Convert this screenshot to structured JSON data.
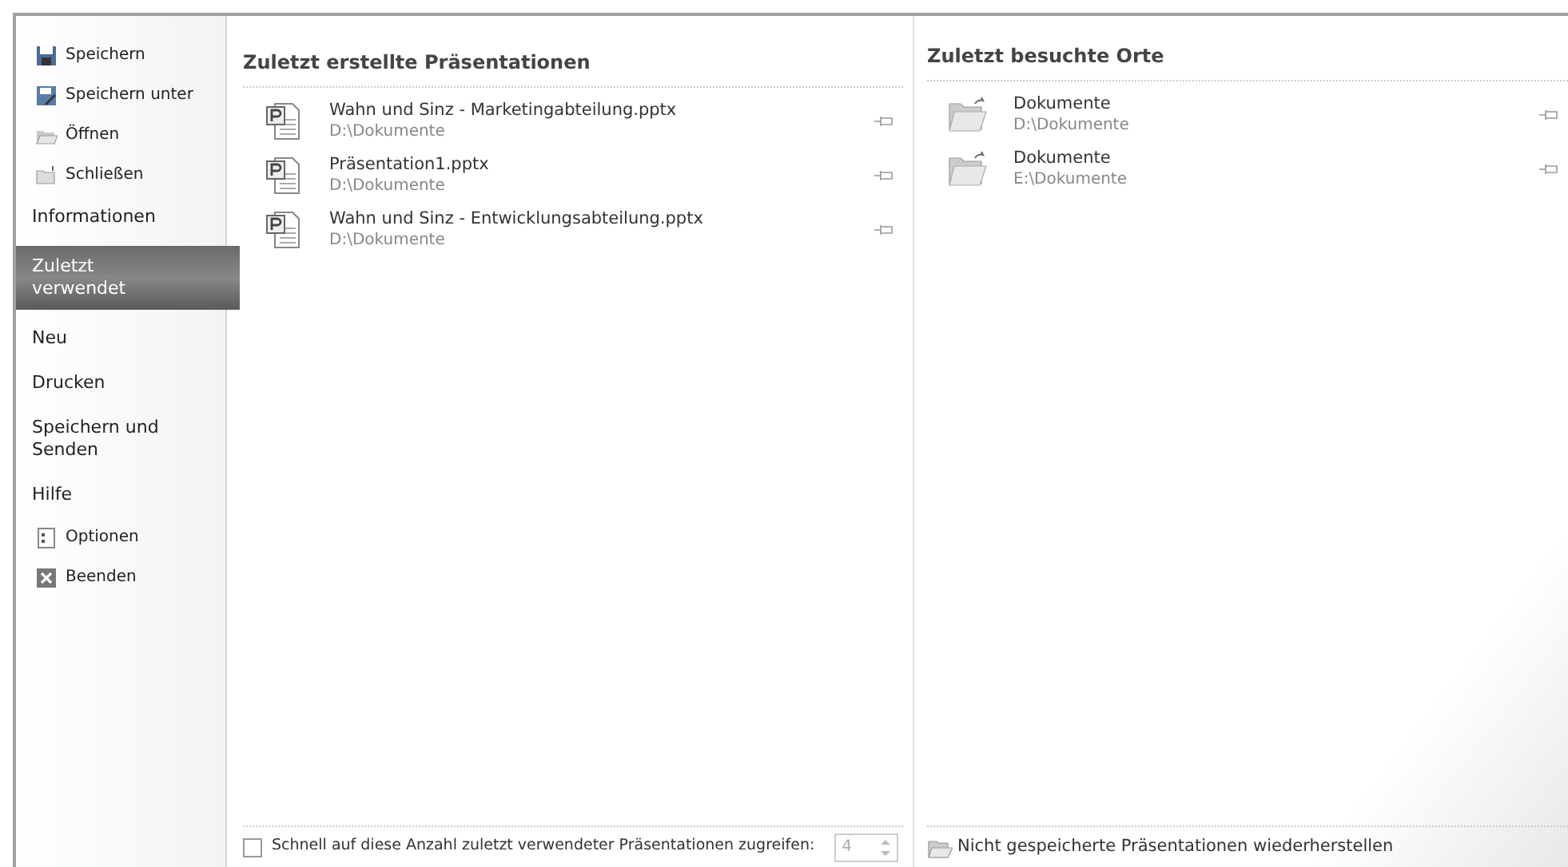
{
  "sidebar": {
    "items": [
      {
        "kind": "command",
        "label": "Speichern",
        "selected": false
      },
      {
        "kind": "command",
        "label": "Speichern unter",
        "selected": false
      },
      {
        "kind": "command",
        "label": "Öffnen",
        "selected": false
      },
      {
        "kind": "command",
        "label": "Schließen",
        "selected": false
      },
      {
        "kind": "tab",
        "label": "Informationen",
        "selected": false
      },
      {
        "kind": "tab",
        "label": "Zuletzt verwendet",
        "selected": true
      },
      {
        "kind": "tab",
        "label": "Neu",
        "selected": false
      },
      {
        "kind": "tab",
        "label": "Drucken",
        "selected": false
      },
      {
        "kind": "tab",
        "label": "Speichern und Senden",
        "selected": false
      },
      {
        "kind": "tab",
        "label": "Hilfe",
        "selected": false
      },
      {
        "kind": "command",
        "label": "Optionen",
        "selected": false
      },
      {
        "kind": "command",
        "label": "Beenden",
        "selected": false
      }
    ]
  },
  "recent_presentations": {
    "title": "Zuletzt erstellte Präsentationen",
    "items": [
      {
        "name": "Wahn und Sinz - Marketingabteilung.pptx",
        "path": "D:\\Dokumente"
      },
      {
        "name": "Präsentation1.pptx",
        "path": "D:\\Dokumente"
      },
      {
        "name": "Wahn und Sinz - Entwicklungsabteilung.pptx",
        "path": "D:\\Dokumente"
      }
    ],
    "quick_access": {
      "label": "Schnell auf diese Anzahl zuletzt verwendeter Präsentationen zugreifen:",
      "checked": false,
      "value": "4"
    }
  },
  "recent_places": {
    "title": "Zuletzt besuchte Orte",
    "items": [
      {
        "name": "Dokumente",
        "path": "D:\\Dokumente"
      },
      {
        "name": "Dokumente",
        "path": "E:\\Dokumente"
      }
    ],
    "recover_link": "Nicht gespeicherte Präsentationen wiederherstellen"
  }
}
